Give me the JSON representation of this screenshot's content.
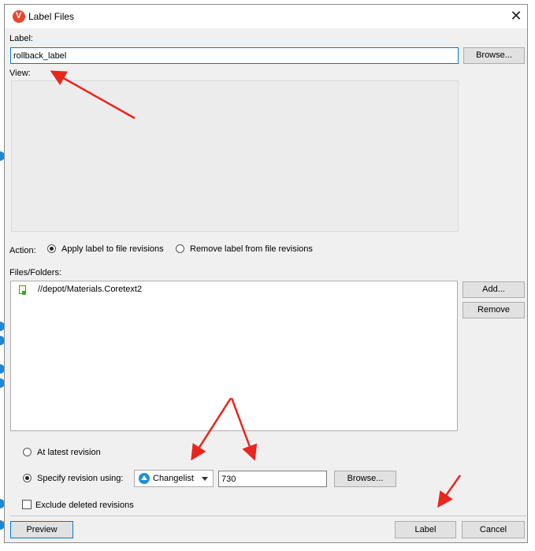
{
  "dialog": {
    "title": "Label Files",
    "close_glyph": "✕"
  },
  "label_section": {
    "label": "Label:",
    "value": "rollback_label",
    "browse_label": "Browse..."
  },
  "view_section": {
    "label": "View:"
  },
  "action_section": {
    "label": "Action:",
    "options": [
      {
        "label": "Apply label to file revisions",
        "selected": true
      },
      {
        "label": "Remove label from file revisions",
        "selected": false
      }
    ]
  },
  "files_section": {
    "label": "Files/Folders:",
    "items": [
      "//depot/Materials.Coretext2"
    ],
    "add_label": "Add...",
    "remove_label": "Remove"
  },
  "revision_section": {
    "latest_label": "At latest revision",
    "latest_selected": false,
    "specify_label": "Specify revision using:",
    "specify_selected": true,
    "type_value": "Changelist",
    "revision_value": "730",
    "browse_label": "Browse...",
    "exclude_label": "Exclude deleted revisions",
    "exclude_checked": false
  },
  "footer": {
    "preview_label": "Preview",
    "label_button": "Label",
    "cancel_button": "Cancel"
  },
  "colors": {
    "accent": "#0078d7",
    "annotation_arrow": "#e8261e",
    "dialog_bg": "#f0f0f0"
  }
}
